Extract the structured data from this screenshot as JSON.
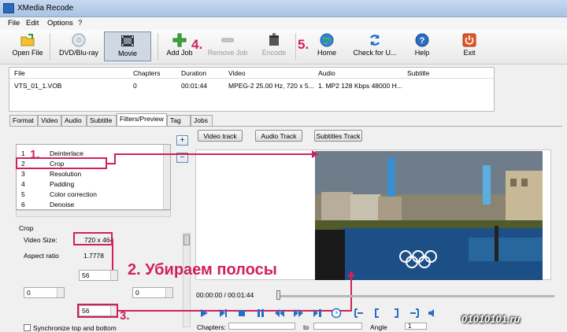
{
  "window": {
    "title": "XMedia Recode"
  },
  "menu": [
    "File",
    "Edit",
    "Options",
    "?"
  ],
  "toolbar": {
    "open_file": "Open File",
    "dvd": "DVD/Blu-ray",
    "movie": "Movie",
    "add_job": "Add Job",
    "remove_job": "Remove Job",
    "encode": "Encode",
    "home": "Home",
    "check_update": "Check for U...",
    "help": "Help",
    "exit": "Exit"
  },
  "annotations": {
    "step1": "1.",
    "step2": "2. Убираем полосы",
    "step3": "3.",
    "step4": "4.",
    "step5": "5."
  },
  "filelist": {
    "headers": [
      "File",
      "Chapters",
      "Duration",
      "Video",
      "Audio",
      "Subtitle"
    ],
    "row": [
      "VTS_01_1.VOB",
      "0",
      "00:01:44",
      "MPEG-2 25.00 Hz, 720 x 5...",
      "1. MP2 128 Kbps 48000 H...",
      ""
    ]
  },
  "tabs": [
    "Format",
    "Video",
    "Audio",
    "Subtitle",
    "Filters/Preview",
    "Tag",
    "Jobs"
  ],
  "active_tab": "Filters/Preview",
  "filters": [
    {
      "num": "1",
      "name": "Deinterlace"
    },
    {
      "num": "2",
      "name": "Crop"
    },
    {
      "num": "3",
      "name": "Resolution"
    },
    {
      "num": "4",
      "name": "Padding"
    },
    {
      "num": "5",
      "name": "Color correction"
    },
    {
      "num": "6",
      "name": "Denoise"
    }
  ],
  "crop": {
    "group_title": "Crop",
    "video_size_label": "Video Size:",
    "video_size_value": "720 x 464",
    "aspect_label": "Aspect ratio",
    "aspect_value": "1.7778",
    "top": "56",
    "left": "0",
    "right": "0",
    "bottom": "56",
    "sync_label": "Synchronize top and bottom"
  },
  "tracks": {
    "video": "Video track",
    "audio": "Audio Track",
    "subtitles": "Subtitles Track"
  },
  "player": {
    "timecode": "00:00:00 / 00:01:44"
  },
  "bottom": {
    "chapters_label": "Chapters:",
    "to_label": "to",
    "angle_label": "Angle",
    "angle_value": "1"
  },
  "watermark": "01010101.ru",
  "colors": {
    "accent_red": "#d0215b"
  }
}
